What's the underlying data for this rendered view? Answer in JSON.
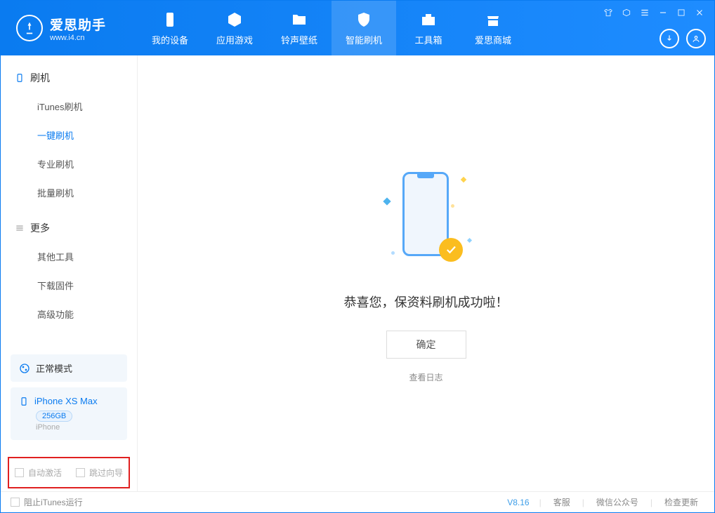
{
  "app": {
    "title": "爱思助手",
    "url": "www.i4.cn"
  },
  "nav": {
    "tabs": [
      {
        "label": "我的设备"
      },
      {
        "label": "应用游戏"
      },
      {
        "label": "铃声壁纸"
      },
      {
        "label": "智能刷机"
      },
      {
        "label": "工具箱"
      },
      {
        "label": "爱思商城"
      }
    ]
  },
  "sidebar": {
    "group1_title": "刷机",
    "group1_items": [
      {
        "label": "iTunes刷机"
      },
      {
        "label": "一键刷机"
      },
      {
        "label": "专业刷机"
      },
      {
        "label": "批量刷机"
      }
    ],
    "group2_title": "更多",
    "group2_items": [
      {
        "label": "其他工具"
      },
      {
        "label": "下载固件"
      },
      {
        "label": "高级功能"
      }
    ],
    "mode_label": "正常模式",
    "device_name": "iPhone XS Max",
    "device_capacity": "256GB",
    "device_type": "iPhone",
    "checkbox1_label": "自动激活",
    "checkbox2_label": "跳过向导"
  },
  "main": {
    "success_message": "恭喜您，保资料刷机成功啦！",
    "ok_button": "确定",
    "view_log": "查看日志"
  },
  "footer": {
    "block_itunes_label": "阻止iTunes运行",
    "version": "V8.16",
    "link1": "客服",
    "link2": "微信公众号",
    "link3": "检查更新"
  }
}
